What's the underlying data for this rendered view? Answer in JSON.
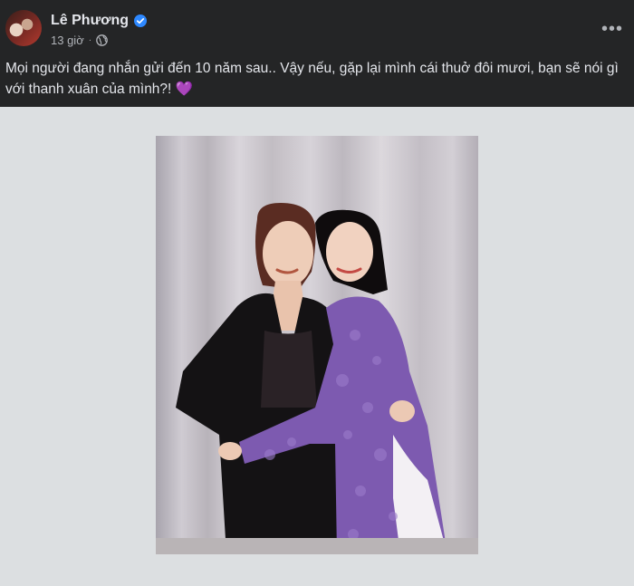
{
  "post": {
    "author_name": "Lê Phương",
    "time": "13 giờ",
    "separator": "·",
    "text": "Mọi người đang nhắn gửi đến 10 năm sau.. Vậy nếu, gặp lại mình cái thuở đôi mươi, bạn sẽ nói gì với thanh xuân của mình?!",
    "emoji": "💜",
    "more_label": "•••"
  },
  "icons": {
    "verified": "verified-badge-icon",
    "audience": "globe-icon",
    "more": "more-options-icon"
  },
  "colors": {
    "background": "#242526",
    "text": "#e4e6eb",
    "secondary_text": "#b0b3b8",
    "verified": "#2d88ff",
    "ao_dai": "#7d5ab0",
    "photo_backdrop": "#dcdfe1"
  }
}
